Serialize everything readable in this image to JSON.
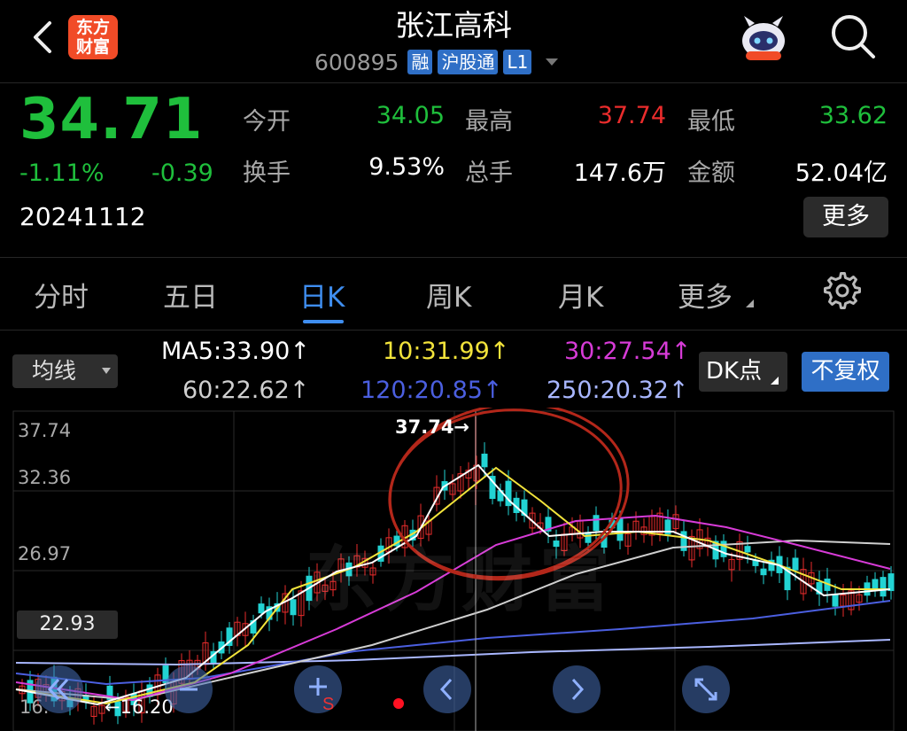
{
  "header": {
    "logo_text": [
      "东方",
      "财富"
    ],
    "title": "张江高科",
    "code": "600895",
    "tags": [
      "融",
      "沪股通",
      "L1"
    ]
  },
  "quote": {
    "price": "34.71",
    "change_pct": "-1.11%",
    "change": "-0.39",
    "date": "20241112",
    "stats": [
      {
        "label": "今开",
        "value": "34.05",
        "color": "green"
      },
      {
        "label": "最高",
        "value": "37.74",
        "color": "red"
      },
      {
        "label": "最低",
        "value": "33.62",
        "color": "green"
      },
      {
        "label": "换手",
        "value": "9.53%",
        "color": "white"
      },
      {
        "label": "总手",
        "value": "147.6万",
        "color": "white"
      },
      {
        "label": "金额",
        "value": "52.04亿",
        "color": "white"
      }
    ],
    "more_label": "更多"
  },
  "tabs": [
    "分时",
    "五日",
    "日K",
    "周K",
    "月K",
    "更多"
  ],
  "active_tab": "日K",
  "ma": {
    "select_label": "均线",
    "values": [
      {
        "text": "MA5:33.90↑",
        "color": "#ffffff"
      },
      {
        "text": "10:31.99↑",
        "color": "#f2e33b"
      },
      {
        "text": "30:27.54↑",
        "color": "#d73bd7"
      },
      {
        "text": "60:22.62↑",
        "color": "#cfcfcf"
      },
      {
        "text": "120:20.85↑",
        "color": "#4b5fe0"
      },
      {
        "text": "250:20.32↑",
        "color": "#a9b7ff"
      }
    ],
    "dk_label": "DK点",
    "adj_label": "不复权"
  },
  "chart": {
    "y_labels": [
      "37.74",
      "32.36",
      "26.97",
      "22.93",
      "16."
    ],
    "peak_label": "37.74→",
    "low_label": "←16.20",
    "watermark": "东方财富"
  },
  "colors": {
    "up": "#ea2c2c",
    "down": "#1fbf3c",
    "candle_down": "#22d3d3",
    "accent": "#3f8ef0"
  }
}
